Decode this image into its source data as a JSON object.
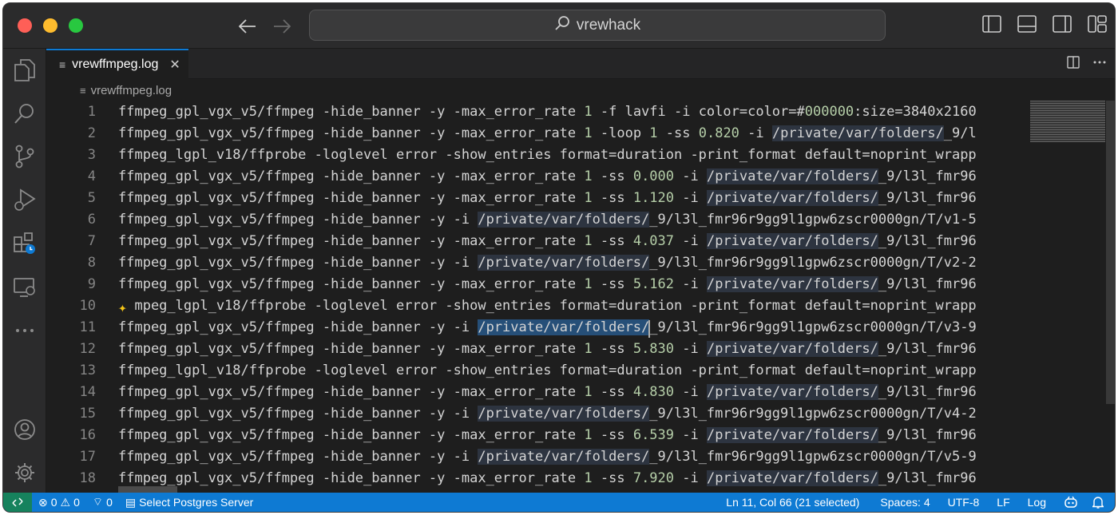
{
  "window": {
    "search_text": "vrewhack"
  },
  "tab": {
    "filename": "vrewffmpeg.log",
    "close_symbol": "✕"
  },
  "breadcrumb": {
    "filename": "vrewffmpeg.log"
  },
  "editor": {
    "lines": [
      {
        "num": "1",
        "parts": [
          {
            "t": "ffmpeg_gpl_vgx_v5/ffmpeg -hide_banner -y -max_error_rate "
          },
          {
            "t": "1",
            "c": "n"
          },
          {
            "t": " -f lavfi -i color=color=#"
          },
          {
            "t": "000000",
            "c": "n"
          },
          {
            "t": ":size=3840x2160"
          }
        ]
      },
      {
        "num": "2",
        "parts": [
          {
            "t": "ffmpeg_gpl_vgx_v5/ffmpeg -hide_banner -y -max_error_rate "
          },
          {
            "t": "1",
            "c": "n"
          },
          {
            "t": " -loop "
          },
          {
            "t": "1",
            "c": "n"
          },
          {
            "t": " -ss "
          },
          {
            "t": "0.820",
            "c": "n"
          },
          {
            "t": " -i "
          },
          {
            "t": "/private/var/folders/",
            "c": "h"
          },
          {
            "t": "_9/l"
          }
        ]
      },
      {
        "num": "3",
        "parts": [
          {
            "t": "ffmpeg_lgpl_v18/ffprobe -loglevel error -show_entries format=duration -print_format default=noprint_wrapp"
          }
        ]
      },
      {
        "num": "4",
        "parts": [
          {
            "t": "ffmpeg_gpl_vgx_v5/ffmpeg -hide_banner -y -max_error_rate "
          },
          {
            "t": "1",
            "c": "n"
          },
          {
            "t": " -ss "
          },
          {
            "t": "0.000",
            "c": "n"
          },
          {
            "t": " -i "
          },
          {
            "t": "/private/var/folders/",
            "c": "h"
          },
          {
            "t": "_9/l3l_fmr96"
          }
        ]
      },
      {
        "num": "5",
        "parts": [
          {
            "t": "ffmpeg_gpl_vgx_v5/ffmpeg -hide_banner -y -max_error_rate "
          },
          {
            "t": "1",
            "c": "n"
          },
          {
            "t": " -ss "
          },
          {
            "t": "1.120",
            "c": "n"
          },
          {
            "t": " -i "
          },
          {
            "t": "/private/var/folders/",
            "c": "h"
          },
          {
            "t": "_9/l3l_fmr96"
          }
        ]
      },
      {
        "num": "6",
        "parts": [
          {
            "t": "ffmpeg_gpl_vgx_v5/ffmpeg -hide_banner -y -i "
          },
          {
            "t": "/private/var/folders/",
            "c": "h"
          },
          {
            "t": "_9/l3l_fmr96r9gg9l1gpw6zscr0000gn/T/v1-5"
          }
        ]
      },
      {
        "num": "7",
        "parts": [
          {
            "t": "ffmpeg_gpl_vgx_v5/ffmpeg -hide_banner -y -max_error_rate "
          },
          {
            "t": "1",
            "c": "n"
          },
          {
            "t": " -ss "
          },
          {
            "t": "4.037",
            "c": "n"
          },
          {
            "t": " -i "
          },
          {
            "t": "/private/var/folders/",
            "c": "h"
          },
          {
            "t": "_9/l3l_fmr96"
          }
        ]
      },
      {
        "num": "8",
        "parts": [
          {
            "t": "ffmpeg_gpl_vgx_v5/ffmpeg -hide_banner -y -i "
          },
          {
            "t": "/private/var/folders/",
            "c": "h"
          },
          {
            "t": "_9/l3l_fmr96r9gg9l1gpw6zscr0000gn/T/v2-2"
          }
        ]
      },
      {
        "num": "9",
        "parts": [
          {
            "t": "ffmpeg_gpl_vgx_v5/ffmpeg -hide_banner -y -max_error_rate "
          },
          {
            "t": "1",
            "c": "n"
          },
          {
            "t": " -ss "
          },
          {
            "t": "5.162",
            "c": "n"
          },
          {
            "t": " -i "
          },
          {
            "t": "/private/var/folders/",
            "c": "h"
          },
          {
            "t": "_9/l3l_fmr96"
          }
        ]
      },
      {
        "num": "10",
        "spark": true,
        "parts": [
          {
            "t": "  mpeg_lgpl_v18/ffprobe -loglevel error -show_entries format=duration -print_format default=noprint_wrapp"
          }
        ]
      },
      {
        "num": "11",
        "parts": [
          {
            "t": "ffmpeg_gpl_vgx_v5/ffmpeg -hide_banner -y -i "
          },
          {
            "t": "/private/var/folders/",
            "c": "s"
          },
          {
            "t": "_9/l3l_fmr96r9gg9l1gpw6zscr0000gn/T/v3-9"
          }
        ]
      },
      {
        "num": "12",
        "parts": [
          {
            "t": "ffmpeg_gpl_vgx_v5/ffmpeg -hide_banner -y -max_error_rate "
          },
          {
            "t": "1",
            "c": "n"
          },
          {
            "t": " -ss "
          },
          {
            "t": "5.830",
            "c": "n"
          },
          {
            "t": " -i "
          },
          {
            "t": "/private/var/folders/",
            "c": "h"
          },
          {
            "t": "_9/l3l_fmr96"
          }
        ]
      },
      {
        "num": "13",
        "parts": [
          {
            "t": "ffmpeg_lgpl_v18/ffprobe -loglevel error -show_entries format=duration -print_format default=noprint_wrapp"
          }
        ]
      },
      {
        "num": "14",
        "parts": [
          {
            "t": "ffmpeg_gpl_vgx_v5/ffmpeg -hide_banner -y -max_error_rate "
          },
          {
            "t": "1",
            "c": "n"
          },
          {
            "t": " -ss "
          },
          {
            "t": "4.830",
            "c": "n"
          },
          {
            "t": " -i "
          },
          {
            "t": "/private/var/folders/",
            "c": "h"
          },
          {
            "t": "_9/l3l_fmr96"
          }
        ]
      },
      {
        "num": "15",
        "parts": [
          {
            "t": "ffmpeg_gpl_vgx_v5/ffmpeg -hide_banner -y -i "
          },
          {
            "t": "/private/var/folders/",
            "c": "h"
          },
          {
            "t": "_9/l3l_fmr96r9gg9l1gpw6zscr0000gn/T/v4-2"
          }
        ]
      },
      {
        "num": "16",
        "parts": [
          {
            "t": "ffmpeg_gpl_vgx_v5/ffmpeg -hide_banner -y -max_error_rate "
          },
          {
            "t": "1",
            "c": "n"
          },
          {
            "t": " -ss "
          },
          {
            "t": "6.539",
            "c": "n"
          },
          {
            "t": " -i "
          },
          {
            "t": "/private/var/folders/",
            "c": "h"
          },
          {
            "t": "_9/l3l_fmr96"
          }
        ]
      },
      {
        "num": "17",
        "parts": [
          {
            "t": "ffmpeg_gpl_vgx_v5/ffmpeg -hide_banner -y -i "
          },
          {
            "t": "/private/var/folders/",
            "c": "h"
          },
          {
            "t": "_9/l3l_fmr96r9gg9l1gpw6zscr0000gn/T/v5-9"
          }
        ]
      },
      {
        "num": "18",
        "parts": [
          {
            "t": "ffmpeg_gpl_vgx_v5/ffmpeg -hide_banner -y -max_error_rate "
          },
          {
            "t": "1",
            "c": "n"
          },
          {
            "t": " -ss "
          },
          {
            "t": "7.920",
            "c": "n"
          },
          {
            "t": " -i "
          },
          {
            "t": "/private/var/folders/",
            "c": "h"
          },
          {
            "t": "_9/l3l_fmr96"
          }
        ]
      }
    ]
  },
  "statusbar": {
    "errors": "0",
    "warnings": "0",
    "ports": "0",
    "postgres": "Select Postgres Server",
    "position": "Ln 11, Col 66 (21 selected)",
    "spaces": "Spaces: 4",
    "encoding": "UTF-8",
    "eol": "LF",
    "language": "Log"
  },
  "colors": {
    "statusbar_bg": "#0e7ad3",
    "remote_bg": "#16825d",
    "editor_bg": "#1e1e1e",
    "number_literal": "#b5cea8",
    "selection": "#264f78"
  }
}
